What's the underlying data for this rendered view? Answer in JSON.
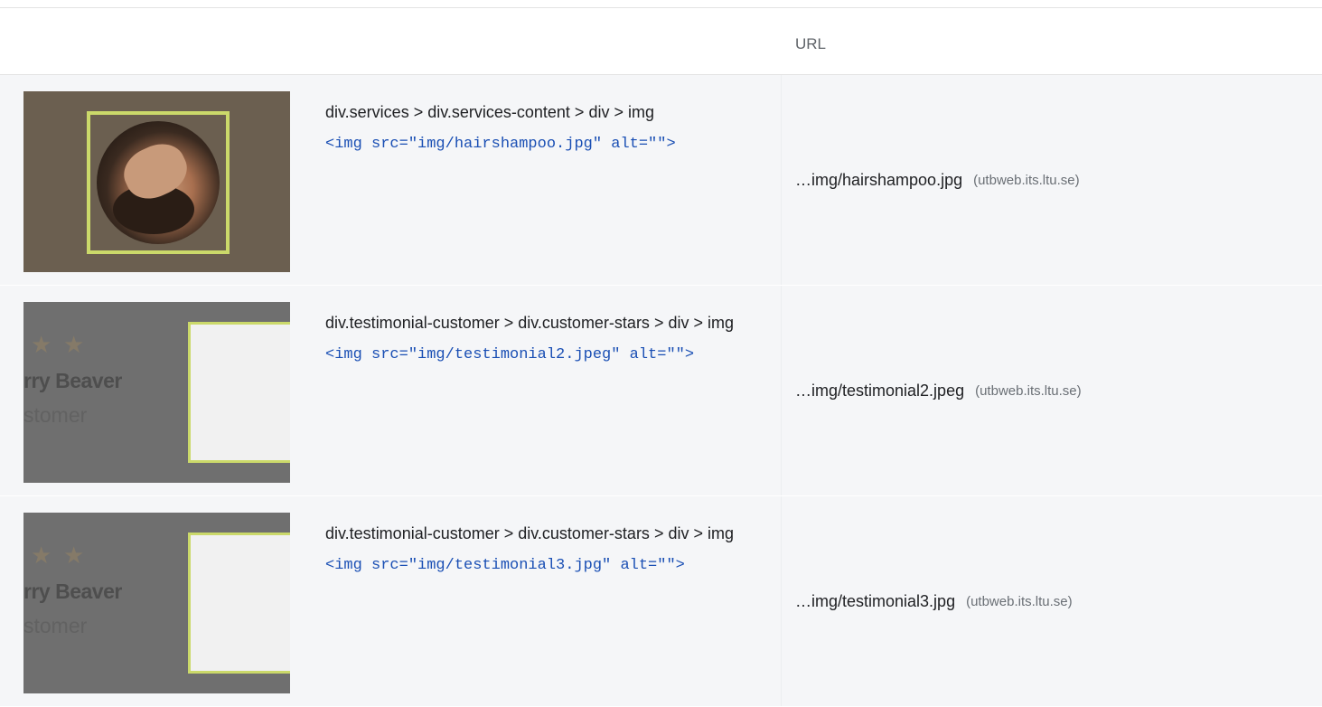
{
  "header": {
    "url_column": "URL"
  },
  "rows": [
    {
      "selector": "div.services > div.services-content > div > img",
      "snippet": "<img src=\"img/hairshampoo.jpg\" alt=\"\">",
      "url_path": "…img/hairshampoo.jpg",
      "url_host": "(utbweb.its.ltu.se)"
    },
    {
      "selector": "div.testimonial-customer > div.customer-stars > div > img",
      "snippet": "<img src=\"img/testimonial2.jpeg\" alt=\"\">",
      "url_path": "…img/testimonial2.jpeg",
      "url_host": "(utbweb.its.ltu.se)",
      "thumb_name": "rry Beaver",
      "thumb_role": "stomer"
    },
    {
      "selector": "div.testimonial-customer > div.customer-stars > div > img",
      "snippet": "<img src=\"img/testimonial3.jpg\" alt=\"\">",
      "url_path": "…img/testimonial3.jpg",
      "url_host": "(utbweb.its.ltu.se)",
      "thumb_name": "rry Beaver",
      "thumb_role": "stomer"
    }
  ],
  "colors": {
    "row_bg": "#f5f6f8",
    "snippet": "#1a4fb4",
    "frame_accent": "#cbd96a"
  }
}
